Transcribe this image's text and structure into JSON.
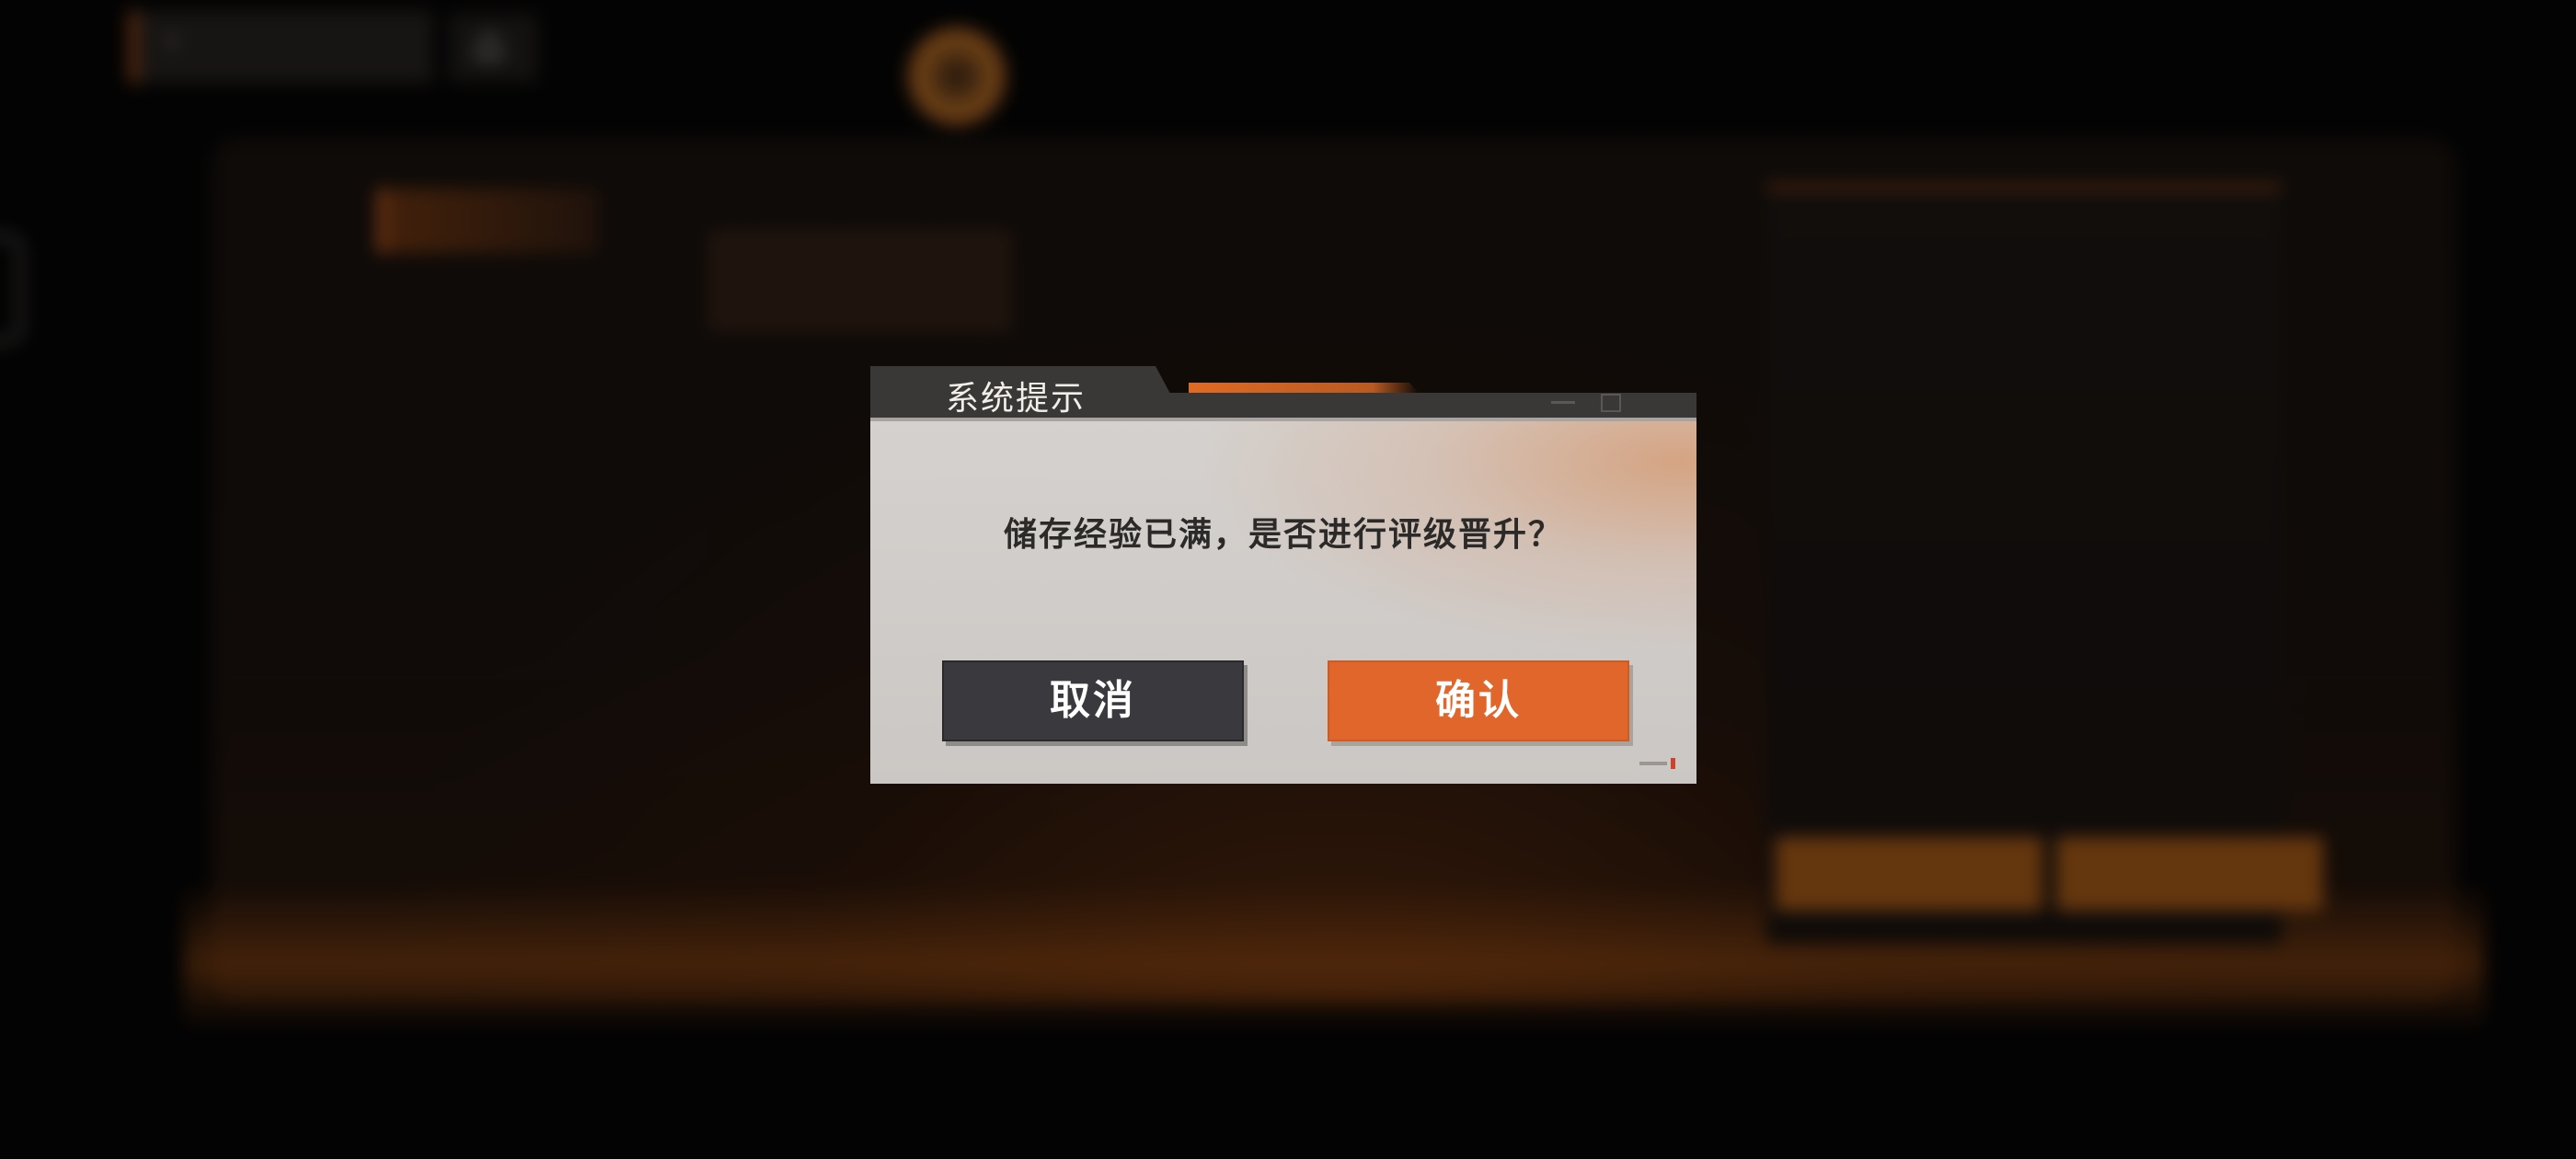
{
  "background": {
    "back_label": "ⅢⅢ",
    "title": "",
    "sidebar_items": [
      "",
      "",
      "",
      "",
      "",
      "",
      "",
      ""
    ],
    "mid_text": "",
    "mid_orange_text": "",
    "right_heading": "",
    "right_sub": "",
    "right_lines": [
      "",
      "",
      "",
      ""
    ]
  },
  "dialog": {
    "title": "系统提示",
    "message": "储存经验已满，是否进行评级晋升？",
    "cancel_label": "取消",
    "confirm_label": "确认"
  },
  "colors": {
    "accent": "#e0662c",
    "cancel_button": "#3a3a3e",
    "dialog_body": "#d0ccc9",
    "dialog_header": "#3a3837"
  },
  "icons": {
    "back": "chevron-left-icon",
    "home": "home-icon",
    "emblem": "emblem-icon"
  }
}
